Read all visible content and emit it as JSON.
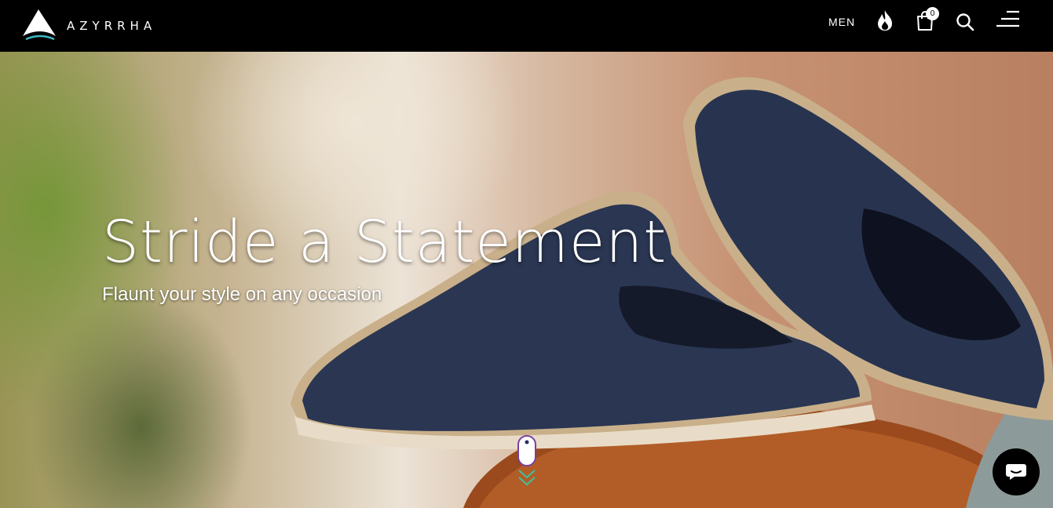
{
  "brand": {
    "name": "AZYRRHA"
  },
  "nav": {
    "men_label": "MEN",
    "cart_count": "0",
    "icons": [
      "fire-icon",
      "cart-icon",
      "search-icon",
      "menu-icon"
    ]
  },
  "hero": {
    "headline": "Stride a Statement",
    "subline": "Flaunt your style on any occasion"
  },
  "colors": {
    "topbar": "#000000",
    "text": "#ffffff",
    "scroll_accent": "#7b3fa0",
    "chevron_accent": "#3fbfa0"
  },
  "chat": {
    "icon": "chat-icon"
  }
}
